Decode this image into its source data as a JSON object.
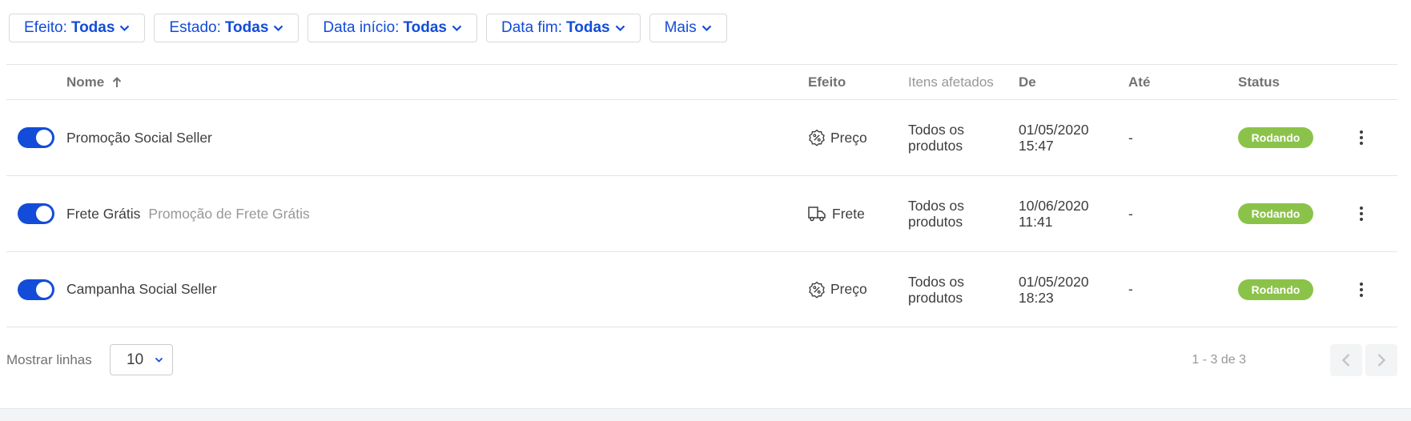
{
  "filters": [
    {
      "label": "Efeito:",
      "value": "Todas"
    },
    {
      "label": "Estado:",
      "value": "Todas"
    },
    {
      "label": "Data início:",
      "value": "Todas"
    },
    {
      "label": "Data fim:",
      "value": "Todas"
    },
    {
      "label": "Mais"
    }
  ],
  "columns": {
    "name": "Nome",
    "effect": "Efeito",
    "items": "Itens afetados",
    "from": "De",
    "to": "Até",
    "status": "Status"
  },
  "rows": [
    {
      "enabled": true,
      "name": "Promoção Social Seller",
      "subtitle": "",
      "effect_icon": "percent-tag-icon",
      "effect": "Preço",
      "items_line1": "Todos os",
      "items_line2": "produtos",
      "from_date": "01/05/2020",
      "from_time": "15:47",
      "to": "-",
      "status": "Rodando"
    },
    {
      "enabled": true,
      "name": "Frete Grátis",
      "subtitle": "Promoção de Frete Grátis",
      "effect_icon": "truck-icon",
      "effect": "Frete",
      "items_line1": "Todos os",
      "items_line2": "produtos",
      "from_date": "10/06/2020",
      "from_time": "11:41",
      "to": "-",
      "status": "Rodando"
    },
    {
      "enabled": true,
      "name": "Campanha Social Seller",
      "subtitle": "",
      "effect_icon": "percent-tag-icon",
      "effect": "Preço",
      "items_line1": "Todos os",
      "items_line2": "produtos",
      "from_date": "01/05/2020",
      "from_time": "18:23",
      "to": "-",
      "status": "Rodando"
    }
  ],
  "pagination": {
    "rows_label": "Mostrar linhas",
    "rows_value": "10",
    "range": "1 - 3 de 3"
  },
  "colors": {
    "accent": "#134cd8",
    "status_running": "#8bc34a"
  }
}
